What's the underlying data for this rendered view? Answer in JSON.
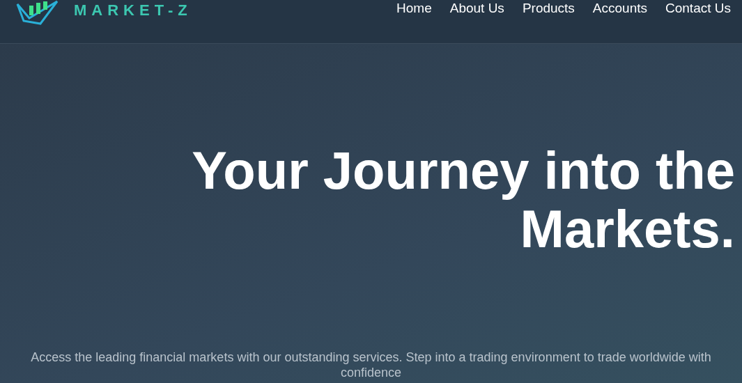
{
  "header": {
    "logo_text": "MARKET-Z",
    "nav": [
      {
        "label": "Home"
      },
      {
        "label": "About Us"
      },
      {
        "label": "Products"
      },
      {
        "label": "Accounts"
      },
      {
        "label": "Contact Us"
      }
    ]
  },
  "hero": {
    "headline": "Your Journey into the Markets.",
    "text": "Access the leading financial markets with our outstanding services. Step into a trading environment to trade worldwide with confidence"
  }
}
